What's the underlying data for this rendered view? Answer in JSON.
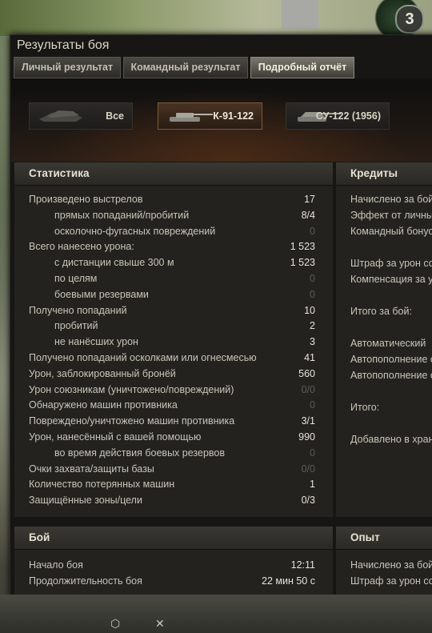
{
  "window_title": "Результаты боя",
  "badge_number": "3",
  "tabs": [
    {
      "label": "Личный результат",
      "active": false
    },
    {
      "label": "Командный результат",
      "active": false
    },
    {
      "label": "Подробный отчёт",
      "active": true
    }
  ],
  "vehicles": [
    {
      "label": "Все",
      "selected": false
    },
    {
      "label": "К-91-122",
      "selected": true
    },
    {
      "label": "СУ-122 (1956)",
      "selected": false
    }
  ],
  "statistics": {
    "title": "Статистика",
    "rows": [
      {
        "label": "Произведено выстрелов",
        "value": "17",
        "indent": false,
        "dim": false
      },
      {
        "label": "прямых попаданий/пробитий",
        "value": "8/4",
        "indent": true,
        "dim": false
      },
      {
        "label": "осколочно-фугасных повреждений",
        "value": "0",
        "indent": true,
        "dim": true
      },
      {
        "label": "Всего нанесено урона:",
        "value": "1 523",
        "indent": false,
        "dim": false
      },
      {
        "label": "с дистанции свыше 300 м",
        "value": "1 523",
        "indent": true,
        "dim": false
      },
      {
        "label": "по целям",
        "value": "0",
        "indent": true,
        "dim": true
      },
      {
        "label": "боевыми резервами",
        "value": "0",
        "indent": true,
        "dim": true
      },
      {
        "label": "Получено попаданий",
        "value": "10",
        "indent": false,
        "dim": false
      },
      {
        "label": "пробитий",
        "value": "2",
        "indent": true,
        "dim": false
      },
      {
        "label": "не нанёсших урон",
        "value": "3",
        "indent": true,
        "dim": false
      },
      {
        "label": "Получено попаданий осколками или огнесмесью",
        "value": "41",
        "indent": false,
        "dim": false
      },
      {
        "label": "Урон, заблокированный бронёй",
        "value": "560",
        "indent": false,
        "dim": false
      },
      {
        "label": "Урон союзникам (уничтожено/повреждений)",
        "value": "0/0",
        "indent": false,
        "dim": true
      },
      {
        "label": "Обнаружено машин противника",
        "value": "0",
        "indent": false,
        "dim": true
      },
      {
        "label": "Повреждено/уничтожено машин противника",
        "value": "3/1",
        "indent": false,
        "dim": false
      },
      {
        "label": "Урон, нанесённый с вашей помощью",
        "value": "990",
        "indent": false,
        "dim": false
      },
      {
        "label": "во время действия боевых резервов",
        "value": "0",
        "indent": true,
        "dim": true
      },
      {
        "label": "Очки захвата/защиты базы",
        "value": "0/0",
        "indent": false,
        "dim": true
      },
      {
        "label": "Количество потерянных машин",
        "value": "1",
        "indent": false,
        "dim": false
      },
      {
        "label": "Защищённые зоны/цели",
        "value": "0/3",
        "indent": false,
        "dim": false
      }
    ]
  },
  "credits": {
    "title": "Кредиты",
    "rows": [
      {
        "label": "Начислено за бой",
        "gap": false
      },
      {
        "label": "Эффект от личны",
        "gap": false
      },
      {
        "label": "Командный бонус",
        "gap": false
      },
      {
        "label": "Штраф за урон со",
        "gap": true
      },
      {
        "label": "Компенсация за у",
        "gap": false
      },
      {
        "label": "Итого за бой:",
        "gap": true
      },
      {
        "label": "Автоматический",
        "gap": true
      },
      {
        "label": "Автопополнение с",
        "gap": false
      },
      {
        "label": "Автопополнение с",
        "gap": false
      },
      {
        "label": "Итого:",
        "gap": true
      },
      {
        "label": "Добавлено в хран",
        "gap": true
      }
    ]
  },
  "battle": {
    "title": "Бой",
    "rows": [
      {
        "label": "Начало боя",
        "value": "12:11"
      },
      {
        "label": "Продолжительность боя",
        "value": "22 мин 50 с"
      }
    ]
  },
  "experience": {
    "title": "Опыт",
    "rows": [
      {
        "label": "Начислено за бой"
      },
      {
        "label": "Штраф за урон со"
      }
    ]
  }
}
